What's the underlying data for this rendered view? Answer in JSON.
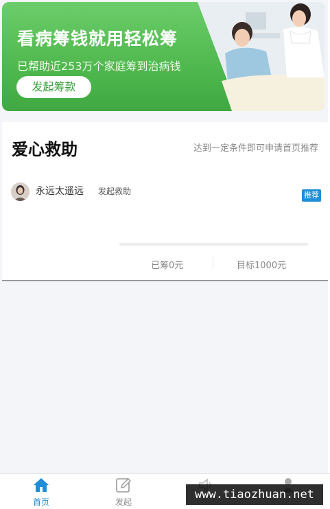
{
  "banner": {
    "title": "看病筹钱就用轻松筹",
    "subtitle": "已帮助近253万个家庭筹到治病钱",
    "button_label": "发起筹款"
  },
  "section": {
    "title": "爱心救助",
    "hint": "达到一定条件即可申请首页推荐"
  },
  "campaign": {
    "user_name": "永远太遥远",
    "action": "发起救助",
    "tag": "推荐",
    "raised_label": "已筹0元",
    "goal_label": "目标1000元",
    "progress": 0
  },
  "tabs": [
    {
      "label": "首页",
      "icon": "home-icon",
      "active": true
    },
    {
      "label": "发起",
      "icon": "edit-icon",
      "active": false
    },
    {
      "label": "",
      "icon": "speaker-icon",
      "active": false
    },
    {
      "label": "",
      "icon": "user-icon",
      "active": false
    }
  ],
  "watermark": "www.tiaozhuan.net",
  "colors": {
    "banner_green": "#4fb84e",
    "accent_blue": "#1e8fd6",
    "button_text_green": "#3aa23d"
  }
}
